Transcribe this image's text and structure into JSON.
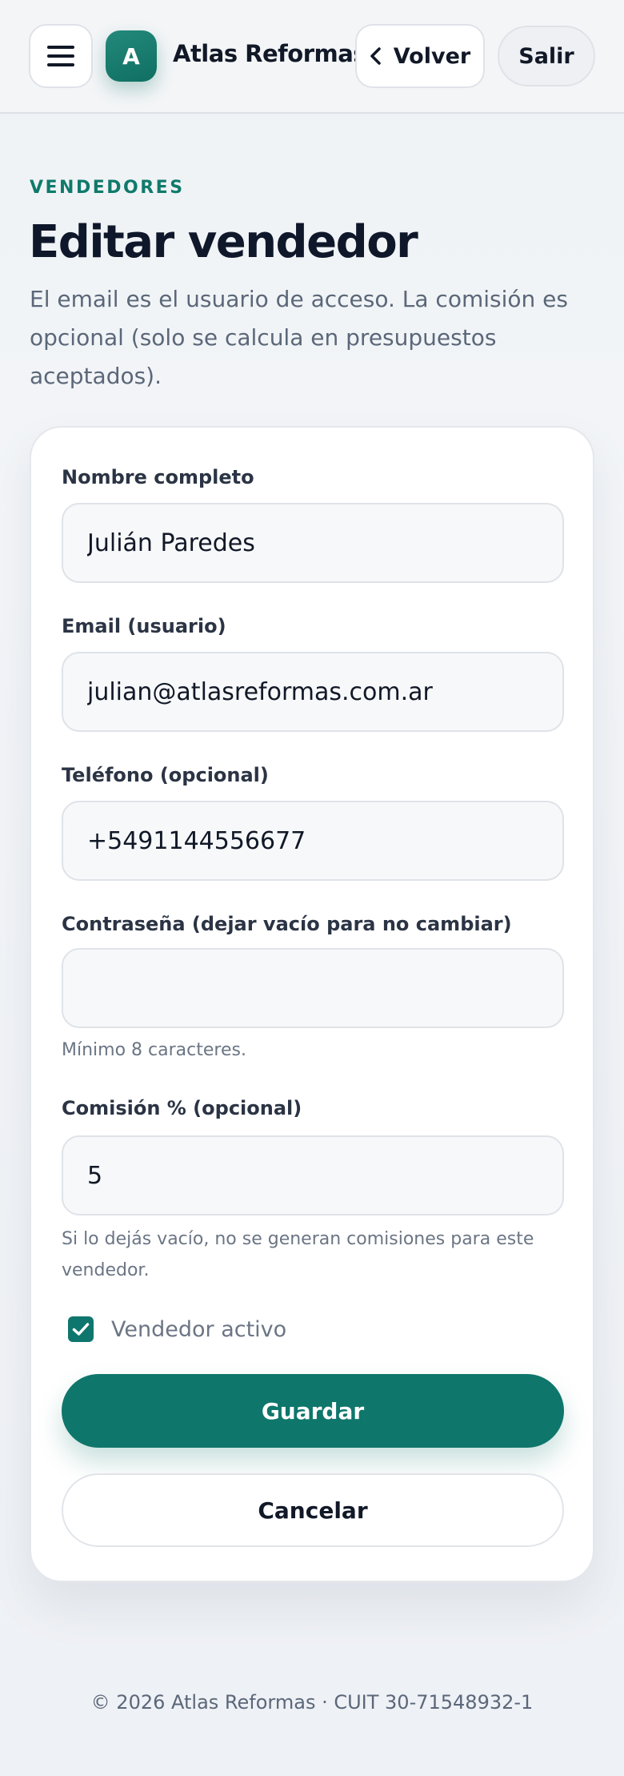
{
  "header": {
    "brand_initial": "A",
    "brand_name": "Atlas Reformas",
    "back_label": "Volver",
    "logout_label": "Salir"
  },
  "page": {
    "eyebrow": "VENDEDORES",
    "title": "Editar vendedor",
    "description": "El email es el usuario de acceso. La comisión es opcional (solo se calcula en presupuestos aceptados)."
  },
  "form": {
    "name": {
      "label": "Nombre completo",
      "value": "Julián Paredes"
    },
    "email": {
      "label": "Email (usuario)",
      "value": "julian@atlasreformas.com.ar"
    },
    "phone": {
      "label": "Teléfono (opcional)",
      "value": "+5491144556677"
    },
    "password": {
      "label": "Contraseña (dejar vacío para no cambiar)",
      "value": "",
      "hint": "Mínimo 8 caracteres."
    },
    "commission": {
      "label": "Comisión % (opcional)",
      "value": "5",
      "hint": "Si lo dejás vacío, no se generan comisiones para este vendedor."
    },
    "active": {
      "label": "Vendedor activo",
      "checked": true
    },
    "save_label": "Guardar",
    "cancel_label": "Cancelar"
  },
  "footer": {
    "text": "© 2026 Atlas Reformas · CUIT 30-71548932-1"
  },
  "colors": {
    "accent": "#0f766b",
    "eyebrow": "#0f7a6b",
    "text_primary": "#111827",
    "text_muted": "#5b6779"
  },
  "icons": {
    "menu": "hamburger-menu-icon",
    "back": "chevron-left-icon",
    "checkbox": "checkmark-icon"
  }
}
